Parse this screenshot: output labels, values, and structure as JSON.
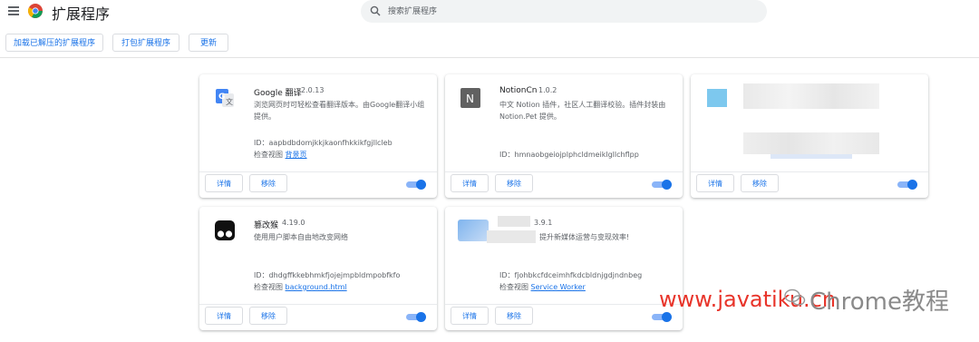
{
  "header": {
    "title": "扩展程序",
    "search_placeholder": "搜索扩展程序"
  },
  "toolbar": {
    "load_unpacked": "加载已解压的扩展程序",
    "pack": "打包扩展程序",
    "update": "更新"
  },
  "common": {
    "details": "详情",
    "remove": "移除",
    "inspect_prefix": "检查视图"
  },
  "extensions": [
    {
      "name": "Google 翻译",
      "version": "2.0.13",
      "description": "浏览网页时可轻松查看翻译版本。由Google翻译小组提供。",
      "id": "ID：aapbdbdomjkkjkaonfhkkikfgjllcleb",
      "inspect_link": "背景页",
      "enabled": true
    },
    {
      "name": "NotionCn",
      "version": "1.0.2",
      "description": "中文 Notion 插件，社区人工翻译校验。插件封装由 Notion.Pet 提供。",
      "id": "ID：hmnaobgeiojplphcldmeiklgllchflpp",
      "inspect_link": "",
      "enabled": true
    },
    {
      "name": "",
      "version": "",
      "description": "",
      "id": "",
      "inspect_link": "",
      "enabled": true
    },
    {
      "name": "篡改猴",
      "version": "4.19.0",
      "description": "使用用户脚本自由地改变网络",
      "id": "ID：dhdgffkkebhmkfjojejmpbldmpobfkfo",
      "inspect_link": "background.html",
      "enabled": true
    },
    {
      "name": "",
      "version": "3.9.1",
      "description": "提升新媒体运营与变现效率!",
      "id": "ID：fjohbkcfdceimhfkdcbldnjgdjndnbeg",
      "inspect_link": "Service Worker",
      "enabled": true
    }
  ],
  "watermark": {
    "site": "www.javatiku.cn",
    "label": "Chrome教程"
  }
}
